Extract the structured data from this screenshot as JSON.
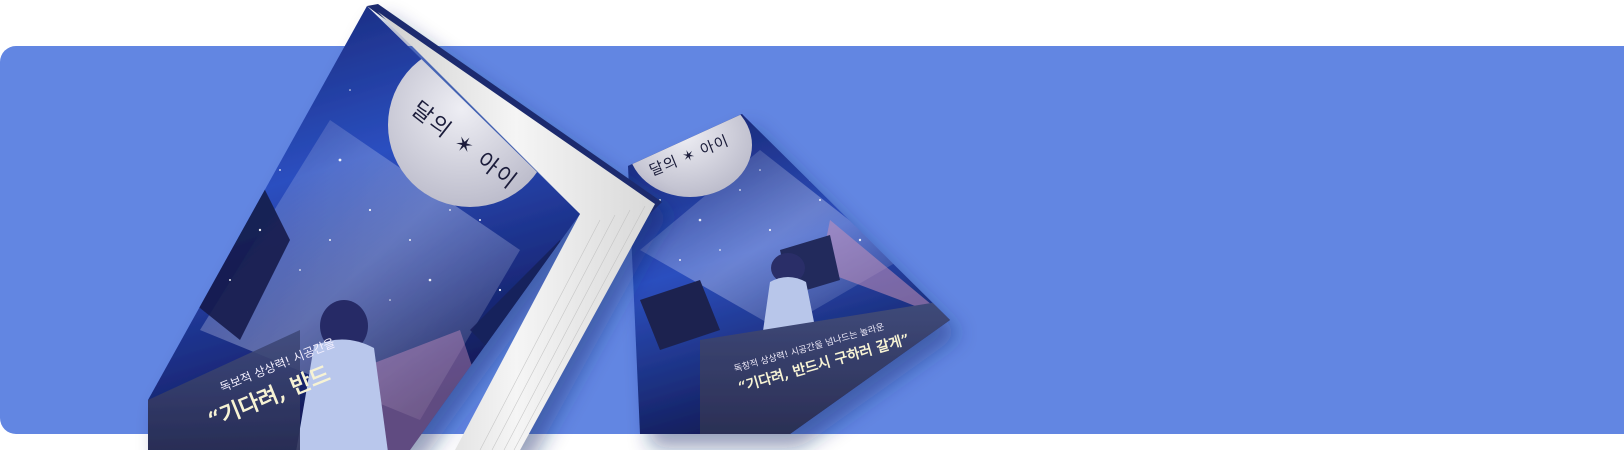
{
  "banner": {
    "background_color": "#6286E2"
  },
  "book": {
    "title": "달의 ✶ 아이",
    "blurb_line_1": "독보적 상상력! 시공간을",
    "blurb_highlight": "“기다려, 반드",
    "small_title": "달의 ✶ 아이",
    "small_blurb_line_1": "독창적 상상력! 시공간을 넘나드는 놀라운",
    "small_blurb_highlight": "“기다려, 반드시 구하러 갈게”",
    "colors": {
      "cover_sky_dark": "#0e1a5c",
      "cover_sky_mid": "#2a4bb5",
      "moon": "#d9d9e4",
      "pages": "#f2f2f2",
      "spine": "#1d2c6e"
    }
  }
}
